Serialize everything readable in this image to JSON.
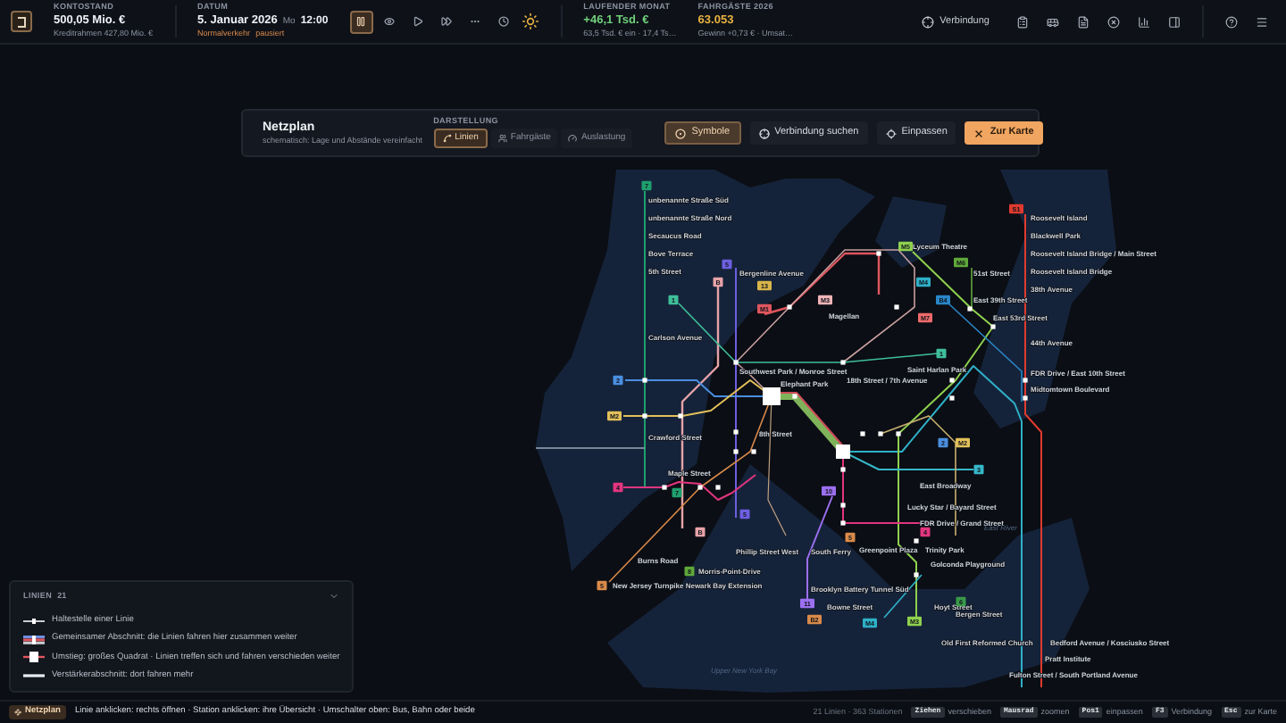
{
  "balance": {
    "label": "KONTOSTAND",
    "value": "500,05 Mio. €",
    "sub": "Kreditrahmen 427,80 Mio. €"
  },
  "date": {
    "label": "DATUM",
    "value": "5. Januar 2026",
    "weekday": "Mo",
    "time": "12:00",
    "mode": "Normalverkehr",
    "state": "pausiert"
  },
  "speed_controls": [
    {
      "kind": "pause",
      "selected": true
    },
    {
      "kind": "watch",
      "selected": false
    },
    {
      "kind": "play",
      "selected": false
    },
    {
      "kind": "fast",
      "selected": false
    },
    {
      "kind": "fastest",
      "selected": false
    },
    {
      "kind": "clock",
      "selected": false
    }
  ],
  "month": {
    "label": "LAUFENDER MONAT",
    "value": "+46,1 Tsd. €",
    "sub": "63,5 Tsd. € ein · 17,4 Ts…"
  },
  "passengers": {
    "label": "FAHRGÄSTE 2026",
    "value": "63.053",
    "sub": "Gewinn +0,73 € · Umsat…"
  },
  "top_actions": {
    "connection": "Verbindung",
    "tools": [
      {
        "kind": "clipboard"
      },
      {
        "kind": "bus"
      },
      {
        "kind": "document"
      },
      {
        "kind": "cancel"
      },
      {
        "kind": "chart"
      },
      {
        "kind": "panel"
      }
    ],
    "extra": [
      {
        "kind": "help"
      },
      {
        "kind": "menu"
      }
    ]
  },
  "panel": {
    "title": "Netzplan",
    "subtitle": "schematisch: Lage und Abstände vereinfacht",
    "view_label": "DARSTELLUNG",
    "tabs": [
      {
        "label": "Linien",
        "selected": true
      },
      {
        "label": "Fahrgäste",
        "selected": false
      },
      {
        "label": "Auslastung",
        "selected": false
      }
    ],
    "buttons": [
      {
        "label": "Symbole",
        "kind": "toggle",
        "selected": true
      },
      {
        "label": "Verbindung suchen",
        "kind": "search"
      },
      {
        "label": "Einpassen",
        "kind": "fit"
      },
      {
        "label": "Zur Karte",
        "kind": "primary"
      }
    ]
  },
  "map": {
    "stations": [
      "unbenannte Straße Süd",
      "unbenannte Straße Nord",
      "Secaucus Road",
      "Bove Terrace",
      "5th Street",
      "Bergenline Avenue",
      "Carlson Avenue",
      "Southwest Park / Monroe Street",
      "Elephant Park",
      "18th Street / 7th Avenue",
      "Crawford Street",
      "8th Street",
      "Maple Street",
      "Phillip Street West",
      "Burns Road",
      "Morris-Point-Drive",
      "New Jersey Turnpike Newark Bay Extension",
      "South Ferry",
      "Brooklyn Battery Tunnel Süd",
      "Bowne Street",
      "Lyceum Theatre",
      "Magellan",
      "51st Street",
      "East 39th Street",
      "East 53rd Street",
      "Saint Harlan Park",
      "Roosevelt Island",
      "Blackwell Park",
      "Roosevelt Island Bridge / Main Street",
      "Roosevelt Island Bridge",
      "38th Avenue",
      "44th Avenue",
      "FDR Drive / East 10th Street",
      "Midtomtown Boulevard",
      "East Broadway",
      "Lucky Star / Bayard Street",
      "FDR Drive / Grand Street",
      "Greenpoint Plaza",
      "Trinity Park",
      "Golconda Playground",
      "Hoyt Street",
      "Bergen Street",
      "Old First Reformed Church",
      "Bedford Avenue / Kosciusko Street",
      "Pratt Institute",
      "Fulton Street / South Portland Avenue"
    ],
    "water_labels": [
      "East River",
      "Upper New York Bay"
    ],
    "badges": [
      {
        "label": "7",
        "color": "#1f9e6e"
      },
      {
        "label": "5",
        "color": "#6d5fe0"
      },
      {
        "label": "B",
        "color": "#e7a3a8"
      },
      {
        "label": "13",
        "color": "#d9b54a"
      },
      {
        "label": "1",
        "color": "#3fbf9a"
      },
      {
        "label": "M1",
        "color": "#e0565e"
      },
      {
        "label": "M3",
        "color": "#f0b4b8"
      },
      {
        "label": "M5",
        "color": "#8fd14f"
      },
      {
        "label": "M6",
        "color": "#5fa83a"
      },
      {
        "label": "M4",
        "color": "#2fb0c8"
      },
      {
        "label": "B4",
        "color": "#2a86c8"
      },
      {
        "label": "M7",
        "color": "#ee6a6a"
      },
      {
        "label": "1",
        "color": "#3fbf9a"
      },
      {
        "label": "2",
        "color": "#4a8fe0"
      },
      {
        "label": "M2",
        "color": "#e2c05a"
      },
      {
        "label": "2",
        "color": "#4a8fe0"
      },
      {
        "label": "M2",
        "color": "#e2c05a"
      },
      {
        "label": "3",
        "color": "#36b7c9"
      },
      {
        "label": "4",
        "color": "#e2357f"
      },
      {
        "label": "7",
        "color": "#1f9e6e"
      },
      {
        "label": "10",
        "color": "#9c6ff0"
      },
      {
        "label": "5",
        "color": "#6d5fe0"
      },
      {
        "label": "B",
        "color": "#e7a3a8"
      },
      {
        "label": "5",
        "color": "#d98a4a"
      },
      {
        "label": "4",
        "color": "#e2357f"
      },
      {
        "label": "8",
        "color": "#5fa83a"
      },
      {
        "label": "5",
        "color": "#d98a4a"
      },
      {
        "label": "11",
        "color": "#9c6ff0"
      },
      {
        "label": "B2",
        "color": "#d98a4a"
      },
      {
        "label": "M4",
        "color": "#2fb0c8"
      },
      {
        "label": "M3",
        "color": "#8fd14f"
      },
      {
        "label": "6",
        "color": "#3a9a4a"
      },
      {
        "label": "S1",
        "color": "#e03a2f"
      }
    ]
  },
  "legend": {
    "title": "LINIEN",
    "count": "21",
    "expanded": true,
    "items": [
      {
        "kind": "stop",
        "text": "Haltestelle einer Linie"
      },
      {
        "kind": "shared",
        "text": "Gemeinsamer Abschnitt: die Linien fahren hier zusammen weiter"
      },
      {
        "kind": "transfer",
        "text": "Umstieg: großes Quadrat · Linien treffen sich und fahren verschieden weiter"
      },
      {
        "kind": "boost",
        "text": "Verstärkerabschnitt: dort fahren mehr"
      }
    ]
  },
  "status_bar": {
    "chip": "Netzplan",
    "hints": "Linie anklicken: rechts öffnen · Station anklicken: ihre Übersicht · Umschalter oben: Bus, Bahn oder beide",
    "stats": "21 Linien · 363 Stationen",
    "shortcuts": [
      {
        "key": "Ziehen",
        "action": "verschieben"
      },
      {
        "key": "Mausrad",
        "action": "zoomen"
      },
      {
        "key": "Pos1",
        "action": "einpassen"
      },
      {
        "key": "F3",
        "action": "Verbindung"
      },
      {
        "key": "Esc",
        "action": "zur Karte"
      }
    ]
  }
}
